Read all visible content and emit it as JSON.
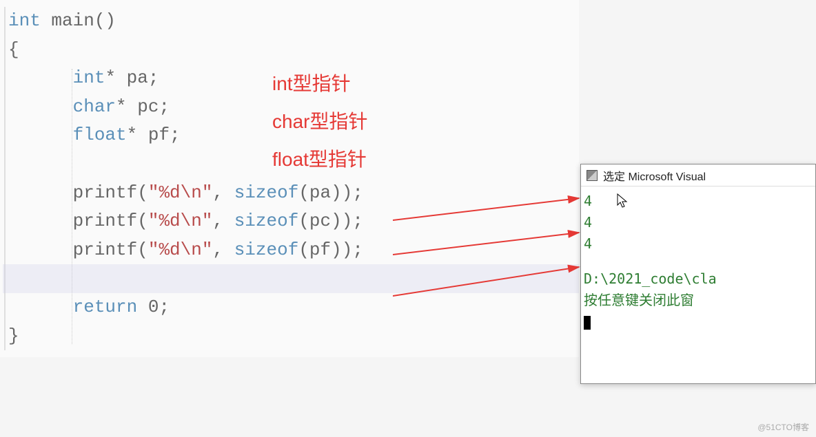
{
  "code": {
    "l1_int": "int",
    "l1_rest": " main()",
    "l2": "{",
    "l3_int": "int",
    "l3_rest": "* pa;",
    "l4_char": "char",
    "l4_rest": "* pc;",
    "l5_float": "float",
    "l5_rest": "* pf;",
    "l6_a": "printf(",
    "l6_str": "\"%d\\n\"",
    "l6_b": ", ",
    "l6_sizeof": "sizeof",
    "l6_c": "(pa));",
    "l7_a": "printf(",
    "l7_str": "\"%d\\n\"",
    "l7_b": ", ",
    "l7_sizeof": "sizeof",
    "l7_c": "(pc));",
    "l8_a": "printf(",
    "l8_str": "\"%d\\n\"",
    "l8_b": ", ",
    "l8_sizeof": "sizeof",
    "l8_c": "(pf));",
    "l9_return": "return",
    "l9_rest": " 0;",
    "l10": "}"
  },
  "annotations": {
    "a1": "int型指针",
    "a2": "char型指针",
    "a3": "float型指针"
  },
  "console": {
    "title": "选定 Microsoft Visual",
    "out1": "4",
    "out2": "4",
    "out3": "4",
    "path": "D:\\2021_code\\cla",
    "prompt": "按任意键关闭此窗"
  },
  "watermark": "@51CTO博客"
}
